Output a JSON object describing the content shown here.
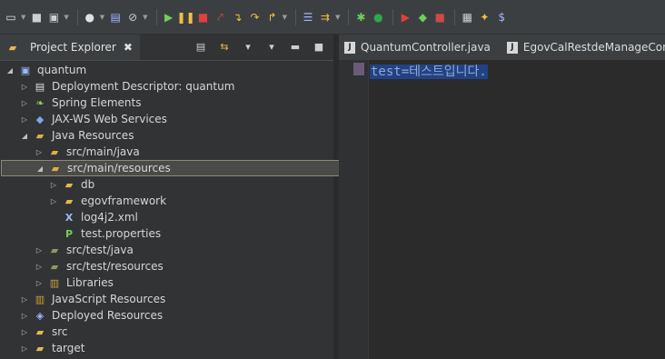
{
  "toolbar": {
    "items": [
      {
        "name": "new-icon",
        "glyph": "▭",
        "color": "#e0e0e0"
      },
      {
        "name": "save-icon",
        "glyph": "■",
        "color": "#cfcfcf"
      },
      {
        "name": "save-all-icon",
        "glyph": "▣",
        "color": "#cfcfcf"
      },
      {
        "name": "profile-icon",
        "glyph": "●",
        "color": "#e0e0e0"
      },
      {
        "name": "terminal-icon",
        "glyph": "▤",
        "color": "#9fb7ff"
      },
      {
        "name": "skip-breakpoints-icon",
        "glyph": "⊘",
        "color": "#cfcfcf"
      },
      {
        "name": "resume-icon",
        "glyph": "▶",
        "color": "#6fcf5a"
      },
      {
        "name": "suspend-icon",
        "glyph": "❚❚",
        "color": "#f0c040"
      },
      {
        "name": "terminate-icon",
        "glyph": "■",
        "color": "#e04040"
      },
      {
        "name": "disconnect-icon",
        "glyph": "⤤",
        "color": "#e04040"
      },
      {
        "name": "step-into-icon",
        "glyph": "↴",
        "color": "#f0c040"
      },
      {
        "name": "step-over-icon",
        "glyph": "↷",
        "color": "#f0c040"
      },
      {
        "name": "step-return-icon",
        "glyph": "↱",
        "color": "#f0c040"
      },
      {
        "name": "drop-to-frame-icon",
        "glyph": "☰",
        "color": "#9fb7ff"
      },
      {
        "name": "use-step-filters-icon",
        "glyph": "⇉",
        "color": "#f0c040"
      },
      {
        "name": "debug-icon",
        "glyph": "✱",
        "color": "#6fcf5a"
      },
      {
        "name": "run-icon",
        "glyph": "●",
        "color": "#2ea84a"
      },
      {
        "name": "run-last-tool-icon",
        "glyph": "▶",
        "color": "#e04040"
      },
      {
        "name": "coverage-icon",
        "glyph": "◆",
        "color": "#6fcf5a"
      },
      {
        "name": "stop-server-icon",
        "glyph": "■",
        "color": "#d04848"
      },
      {
        "name": "open-perspective-icon",
        "glyph": "▦",
        "color": "#cfcfcf"
      },
      {
        "name": "new-java-project-icon",
        "glyph": "✦",
        "color": "#f0c040"
      },
      {
        "name": "new-package-icon",
        "glyph": "$",
        "color": "#9fb7ff"
      }
    ]
  },
  "project_explorer": {
    "title": "Project Explorer",
    "close_glyph": "✖",
    "tree": [
      {
        "label": "quantum",
        "depth": 0,
        "twisty": "◢",
        "icon": "project-icon",
        "glyph": "▣",
        "color": "#9fb7ff"
      },
      {
        "label": "Deployment Descriptor: quantum",
        "depth": 1,
        "twisty": "▷",
        "icon": "deployment-descriptor-icon",
        "glyph": "▤",
        "color": "#e0e0e0"
      },
      {
        "label": "Spring Elements",
        "depth": 1,
        "twisty": "▷",
        "icon": "spring-icon",
        "glyph": "❧",
        "color": "#8fd05a"
      },
      {
        "label": "JAX-WS Web Services",
        "depth": 1,
        "twisty": "▷",
        "icon": "web-services-icon",
        "glyph": "◆",
        "color": "#7aa8e8"
      },
      {
        "label": "Java Resources",
        "depth": 1,
        "twisty": "◢",
        "icon": "java-resources-icon",
        "glyph": "▰",
        "color": "#e0b040"
      },
      {
        "label": "src/main/java",
        "depth": 2,
        "twisty": "▷",
        "icon": "source-folder-icon",
        "glyph": "▰",
        "color": "#e0b040"
      },
      {
        "label": "src/main/resources",
        "depth": 2,
        "twisty": "◢",
        "icon": "source-folder-icon",
        "glyph": "▰",
        "color": "#e0b040",
        "selected": true
      },
      {
        "label": "db",
        "depth": 3,
        "twisty": "▷",
        "icon": "folder-icon",
        "glyph": "▰",
        "color": "#e8b84a"
      },
      {
        "label": "egovframework",
        "depth": 3,
        "twisty": "▷",
        "icon": "folder-icon",
        "glyph": "▰",
        "color": "#e8b84a"
      },
      {
        "label": "log4j2.xml",
        "depth": 3,
        "twisty": "",
        "icon": "xml-file-icon",
        "glyph": "X",
        "color": "#9fb7ff"
      },
      {
        "label": "test.properties",
        "depth": 3,
        "twisty": "",
        "icon": "properties-file-icon",
        "glyph": "P",
        "color": "#6fcf5a"
      },
      {
        "label": "src/test/java",
        "depth": 2,
        "twisty": "▷",
        "icon": "source-folder-icon",
        "glyph": "▰",
        "color": "#8a9a60"
      },
      {
        "label": "src/test/resources",
        "depth": 2,
        "twisty": "▷",
        "icon": "source-folder-icon",
        "glyph": "▰",
        "color": "#8a9a60"
      },
      {
        "label": "Libraries",
        "depth": 2,
        "twisty": "▷",
        "icon": "libraries-icon",
        "glyph": "▥",
        "color": "#c8a040"
      },
      {
        "label": "JavaScript Resources",
        "depth": 1,
        "twisty": "▷",
        "icon": "javascript-resources-icon",
        "glyph": "▥",
        "color": "#d0a030"
      },
      {
        "label": "Deployed Resources",
        "depth": 1,
        "twisty": "▷",
        "icon": "deployed-resources-icon",
        "glyph": "◈",
        "color": "#9fb7ff"
      },
      {
        "label": "src",
        "depth": 1,
        "twisty": "▷",
        "icon": "folder-icon",
        "glyph": "▰",
        "color": "#e8b84a"
      },
      {
        "label": "target",
        "depth": 1,
        "twisty": "▷",
        "icon": "folder-icon",
        "glyph": "▰",
        "color": "#e8b84a"
      }
    ]
  },
  "editor": {
    "tabs": [
      {
        "label": "QuantumController.java"
      },
      {
        "label": "EgovCalRestdeManageContro"
      }
    ],
    "line1": "test=테스트입니다."
  },
  "colors": {
    "selection": "#214283",
    "panel": "#313335",
    "editor_bg": "#2b2b2b"
  }
}
